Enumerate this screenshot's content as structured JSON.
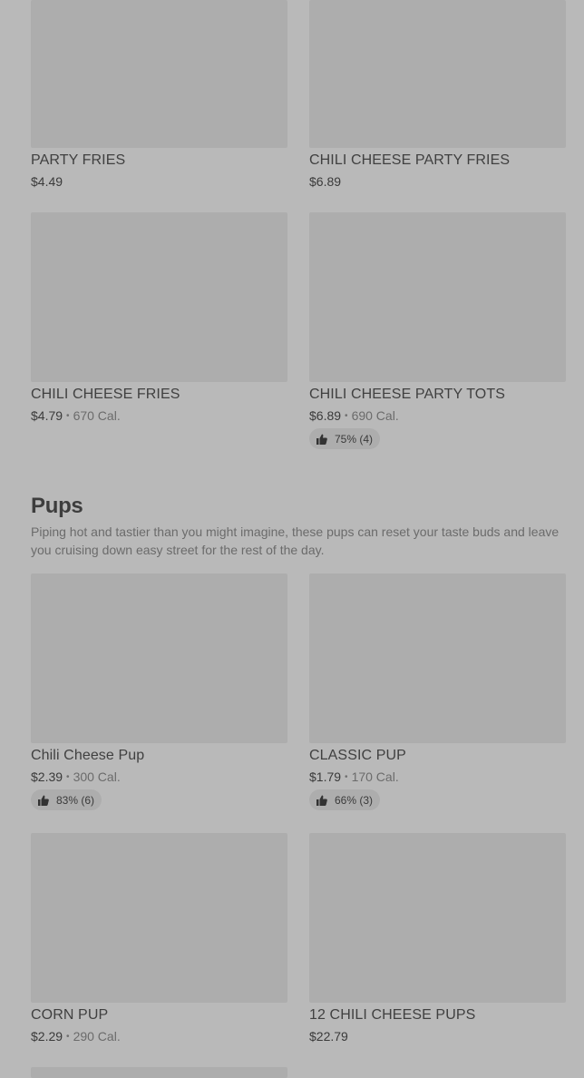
{
  "fries_items": [
    {
      "name": "PARTY FRIES",
      "price": "$4.49"
    },
    {
      "name": "CHILI CHEESE PARTY FRIES",
      "price": "$6.89"
    },
    {
      "name": "CHILI CHEESE FRIES",
      "price": "$4.79",
      "calories": "670 Cal."
    },
    {
      "name": "CHILI CHEESE PARTY TOTS",
      "price": "$6.89",
      "calories": "690 Cal.",
      "rating": "75% (4)"
    }
  ],
  "pups_section": {
    "title": "Pups",
    "description": "Piping hot and tastier than you might imagine, these pups can reset your taste buds and leave you cruising down easy street for the rest of the day."
  },
  "pups_items": [
    {
      "name": "Chili Cheese Pup",
      "price": "$2.39",
      "calories": "300 Cal.",
      "rating": "83% (6)"
    },
    {
      "name": "CLASSIC PUP",
      "price": "$1.79",
      "calories": "170 Cal.",
      "rating": "66% (3)"
    },
    {
      "name": "CORN PUP",
      "price": "$2.29",
      "calories": "290 Cal."
    },
    {
      "name": "12 CHILI CHEESE PUPS",
      "price": "$22.79"
    }
  ],
  "separator": "•",
  "icons": {
    "rating": "thumbs-up-icon"
  },
  "colors": {
    "background": "#b9b9b9",
    "image_placeholder": "#adadad",
    "text": "#404040"
  }
}
